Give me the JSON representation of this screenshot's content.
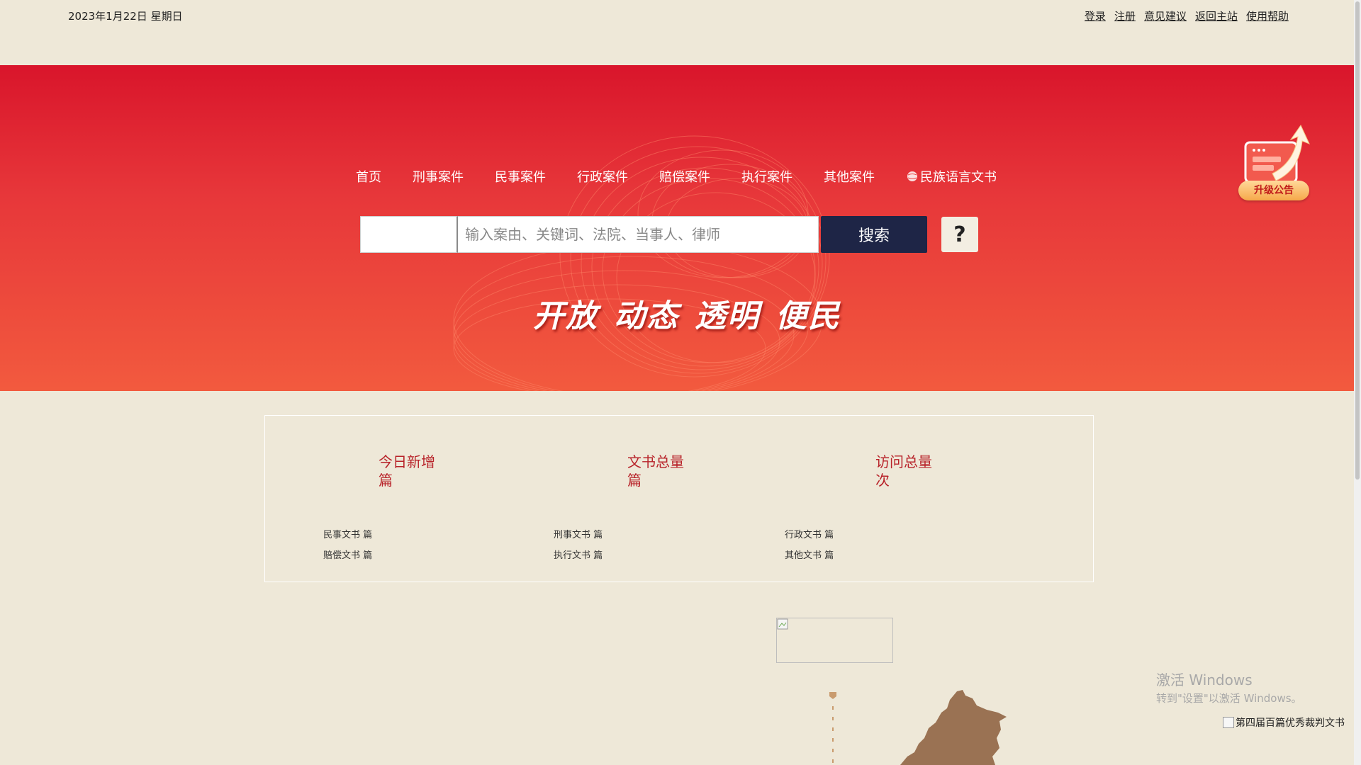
{
  "header": {
    "date": "2023年1月22日 星期日",
    "links": [
      "登录",
      "注册",
      "意见建议",
      "返回主站",
      "使用帮助"
    ]
  },
  "nav": {
    "items": [
      "首页",
      "刑事案件",
      "民事案件",
      "行政案件",
      "赔偿案件",
      "执行案件",
      "其他案件"
    ],
    "ethnic": "民族语言文书"
  },
  "search": {
    "type_value": "",
    "placeholder": "输入案由、关键词、法院、当事人、律师",
    "button": "搜索",
    "help": "?"
  },
  "slogan": [
    "开放",
    "动态",
    "透明",
    "便民"
  ],
  "upgrade": {
    "label": "升级公告"
  },
  "stats": {
    "today": {
      "label": "今日新增",
      "unit": "篇"
    },
    "total": {
      "label": "文书总量",
      "unit": "篇"
    },
    "visits": {
      "label": "访问总量",
      "unit": "次"
    },
    "categories": {
      "civil": "民事文书 篇",
      "criminal": "刑事文书 篇",
      "admin": "行政文书 篇",
      "compensation": "赔偿文书 篇",
      "execution": "执行文书 篇",
      "other": "其他文书 篇"
    }
  },
  "watermark": {
    "line1": "激活 Windows",
    "line2": "转到\"设置\"以激活 Windows。"
  },
  "award": {
    "alt": "第四届百篇优秀裁判文书"
  },
  "colors": {
    "background": "#eee8d8",
    "banner_top": "#d9152b",
    "banner_bottom": "#f25a3e",
    "search_button": "#1e2546",
    "stat_red": "#b8232a",
    "map_brown": "#9a7253"
  }
}
